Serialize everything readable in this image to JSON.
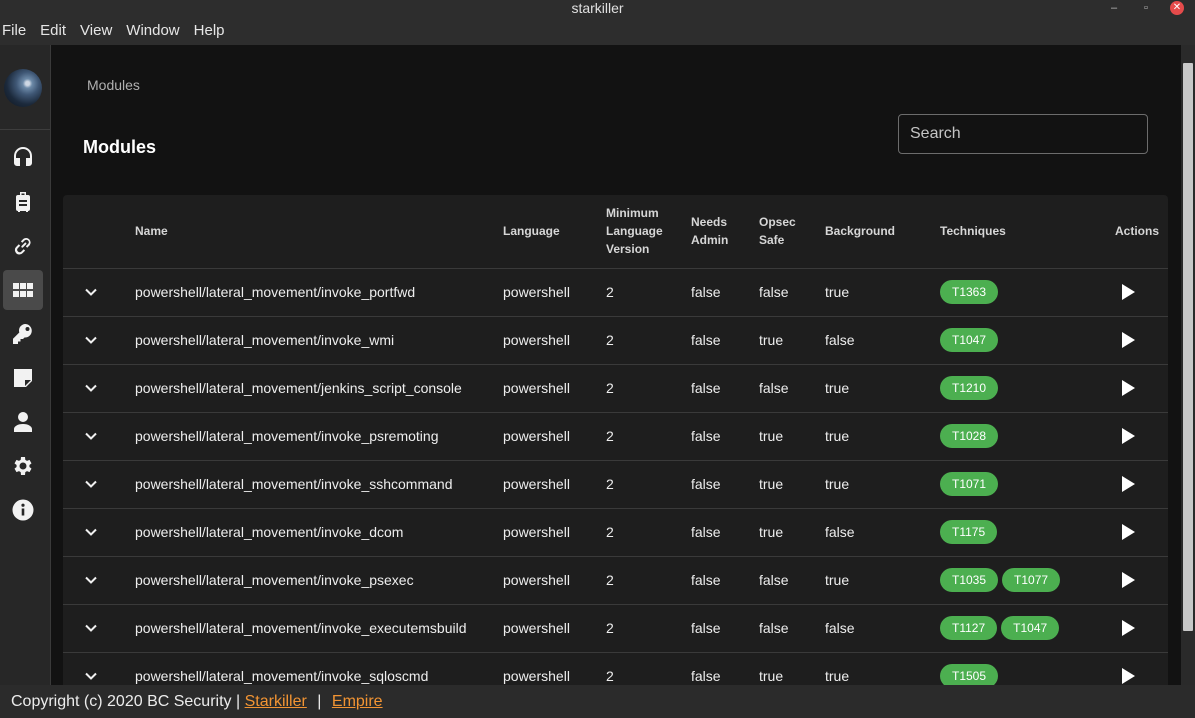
{
  "window": {
    "title": "starkiller",
    "min": "–",
    "max": "▫",
    "close": "✕"
  },
  "menubar": [
    "File",
    "Edit",
    "View",
    "Window",
    "Help"
  ],
  "breadcrumb": "Modules",
  "page_title": "Modules",
  "search": {
    "placeholder": "Search",
    "value": ""
  },
  "table": {
    "headers": {
      "name": "Name",
      "language": "Language",
      "min_version": "Minimum Language Version",
      "needs_admin": "Needs Admin",
      "opsec_safe": "Opsec Safe",
      "background": "Background",
      "techniques": "Techniques",
      "actions": "Actions"
    },
    "rows": [
      {
        "name": "powershell/lateral_movement/invoke_portfwd",
        "language": "powershell",
        "min_version": "2",
        "needs_admin": "false",
        "opsec_safe": "false",
        "background": "true",
        "techniques": [
          "T1363"
        ]
      },
      {
        "name": "powershell/lateral_movement/invoke_wmi",
        "language": "powershell",
        "min_version": "2",
        "needs_admin": "false",
        "opsec_safe": "true",
        "background": "false",
        "techniques": [
          "T1047"
        ]
      },
      {
        "name": "powershell/lateral_movement/jenkins_script_console",
        "language": "powershell",
        "min_version": "2",
        "needs_admin": "false",
        "opsec_safe": "false",
        "background": "true",
        "techniques": [
          "T1210"
        ]
      },
      {
        "name": "powershell/lateral_movement/invoke_psremoting",
        "language": "powershell",
        "min_version": "2",
        "needs_admin": "false",
        "opsec_safe": "true",
        "background": "true",
        "techniques": [
          "T1028"
        ]
      },
      {
        "name": "powershell/lateral_movement/invoke_sshcommand",
        "language": "powershell",
        "min_version": "2",
        "needs_admin": "false",
        "opsec_safe": "true",
        "background": "true",
        "techniques": [
          "T1071"
        ]
      },
      {
        "name": "powershell/lateral_movement/invoke_dcom",
        "language": "powershell",
        "min_version": "2",
        "needs_admin": "false",
        "opsec_safe": "true",
        "background": "false",
        "techniques": [
          "T1175"
        ]
      },
      {
        "name": "powershell/lateral_movement/invoke_psexec",
        "language": "powershell",
        "min_version": "2",
        "needs_admin": "false",
        "opsec_safe": "false",
        "background": "true",
        "techniques": [
          "T1035",
          "T1077"
        ]
      },
      {
        "name": "powershell/lateral_movement/invoke_executemsbuild",
        "language": "powershell",
        "min_version": "2",
        "needs_admin": "false",
        "opsec_safe": "false",
        "background": "false",
        "techniques": [
          "T1127",
          "T1047"
        ]
      },
      {
        "name": "powershell/lateral_movement/invoke_sqloscmd",
        "language": "powershell",
        "min_version": "2",
        "needs_admin": "false",
        "opsec_safe": "true",
        "background": "true",
        "techniques": [
          "T1505"
        ]
      }
    ]
  },
  "sidebar": {
    "items": [
      {
        "icon": "headphones-icon",
        "name": "nav-listeners"
      },
      {
        "icon": "luggage-icon",
        "name": "nav-stagers"
      },
      {
        "icon": "link-icon",
        "name": "nav-agents"
      },
      {
        "icon": "grid-icon",
        "name": "nav-modules",
        "active": true
      },
      {
        "icon": "key-icon",
        "name": "nav-credentials"
      },
      {
        "icon": "note-icon",
        "name": "nav-reporting"
      },
      {
        "icon": "user-icon",
        "name": "nav-users"
      },
      {
        "icon": "gear-icon",
        "name": "nav-settings"
      },
      {
        "icon": "info-icon",
        "name": "nav-about"
      }
    ]
  },
  "footer": {
    "copyright": "Copyright (c) 2020 BC Security |",
    "link1": "Starkiller",
    "separator": "|",
    "link2": "Empire"
  },
  "colors": {
    "accent_chip": "#4caf50",
    "footer_link": "#f29433",
    "background": "#121212",
    "surface": "#1e1e1e"
  }
}
